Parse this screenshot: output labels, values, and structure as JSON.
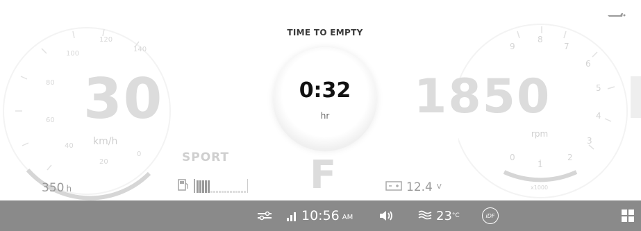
{
  "header": {
    "time_to_empty_label": "TIME TO EMPTY",
    "time_to_empty_value": "0:32",
    "time_to_empty_unit": "hr"
  },
  "speedometer": {
    "value": "30",
    "unit": "km/h",
    "ticks": [
      "20",
      "40",
      "60",
      "80",
      "100",
      "120",
      "140",
      "0"
    ]
  },
  "tachometer": {
    "value": "1850",
    "unit": "rpm",
    "ticks": [
      "9",
      "8",
      "7",
      "6",
      "5",
      "4",
      "3",
      "2",
      "1",
      "0"
    ],
    "scale_label": "x1000"
  },
  "drive": {
    "mode": "SPORT",
    "gear": "F"
  },
  "engine_hours": {
    "value": "350",
    "unit": "h"
  },
  "battery": {
    "value": "12.4",
    "unit": "V"
  },
  "statusbar": {
    "time": "10:56",
    "ampm": "AM",
    "water_temp": "23",
    "temp_unit": "°C",
    "idf_label": "iDF"
  },
  "colors": {
    "statusbar_bg": "#8a8a8a",
    "gauge_ghost": "#dcdcdc",
    "text_dark": "#111111"
  },
  "icons": [
    "boat-icon",
    "fuel-icon",
    "battery-icon",
    "wrench-icon",
    "signal-icon",
    "speaker-icon",
    "water-temp-icon",
    "idf-icon",
    "grid-menu-icon"
  ]
}
